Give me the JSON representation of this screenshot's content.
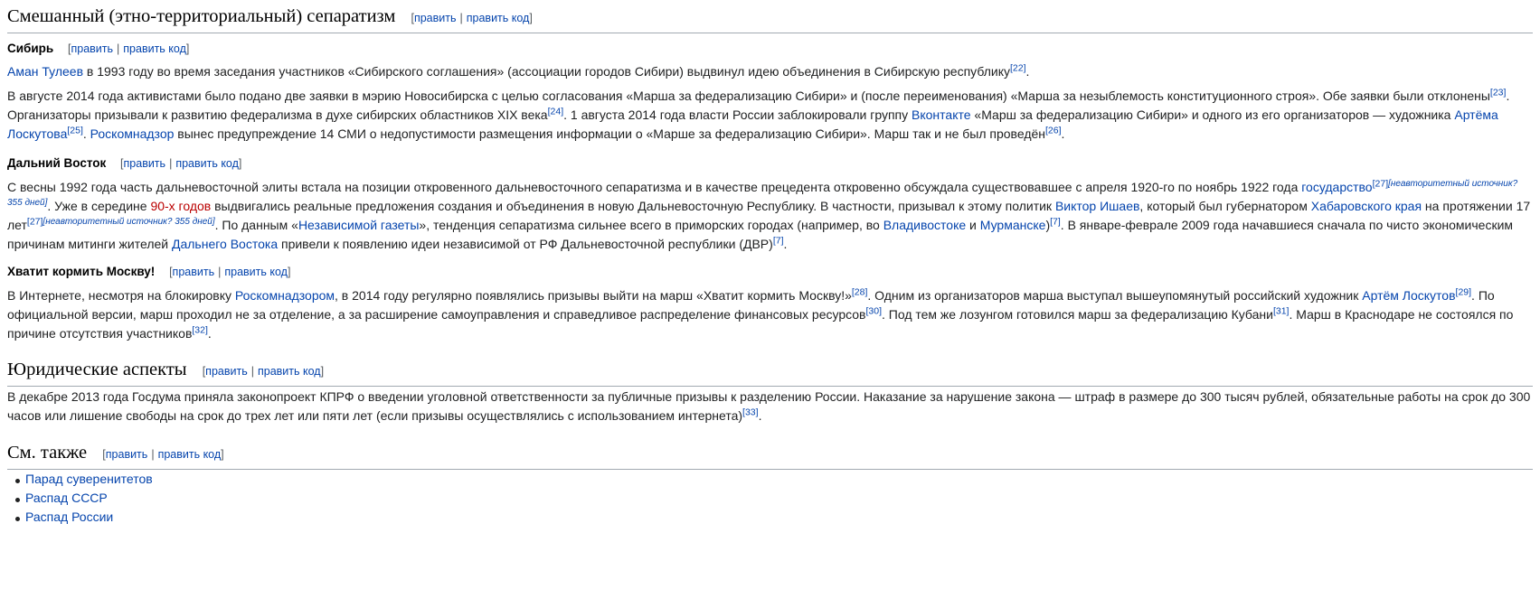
{
  "edit": {
    "edit": "править",
    "edit_code": "править код",
    "open": "[",
    "close": "]",
    "sep": "|"
  },
  "s1": {
    "title": "Смешанный (этно-территориальный) сепаратизм",
    "siberia": {
      "title": "Сибирь",
      "p1": {
        "a1": "Аман Тулеев",
        "t1": " в 1993 году во время заседания участников «Сибирского соглашения» (ассоциации городов Сибири) выдвинул идею объединения в Сибирскую республику",
        "r1": "[22]",
        "t2": "."
      },
      "p2": {
        "t1": "В августе 2014 года активистами было подано две заявки в мэрию Новосибирска с целью согласования «Марша за федерализацию Сибири» и (после переименования) «Марша за незыблемость конституционного строя». Обе заявки были отклонены",
        "r1": "[23]",
        "t2": ". Организаторы призывали к развитию федерализма в духе сибирских областников XIX века",
        "r2": "[24]",
        "t3": ". 1 августа 2014 года власти России заблокировали группу ",
        "a1": "Вконтакте",
        "t4": " «Марш за федерализацию Сибири» и одного из его организаторов — художника ",
        "a2": "Артёма Лоскутова",
        "r3": "[25]",
        "t5": ". ",
        "a3": "Роскомнадзор",
        "t6": " вынес предупреждение 14 СМИ о недопустимости размещения информации о «Марше за федерализацию Сибири». Марш так и не был проведён",
        "r4": "[26]",
        "t7": "."
      }
    },
    "fareast": {
      "title": "Дальний Восток",
      "p1": {
        "t1": "С весны 1992 года часть дальневосточной элиты встала на позиции откровенного дальневосточного сепаратизма и в качестве прецедента откровенно обсуждала существовавшее с апреля 1920-го по ноябрь 1922 года ",
        "a1": "государство",
        "r1": "[27]",
        "n1": "[неавторитетный источник? 355 дней]",
        "t2": ". Уже в середине ",
        "a2": "90-х годов",
        "t3": " выдвигались реальные предложения создания и объединения в новую Дальневосточную Республику. В частности, призывал к этому политик ",
        "a3": "Виктор Ишаев",
        "t4": ", который был губернатором ",
        "a4": "Хабаровского края",
        "t5": " на протяжении 17 лет",
        "r2": "[27]",
        "n2": "[неавторитетный источник? 355 дней]",
        "t6": ". По данным «",
        "a5": "Независимой газеты",
        "t7": "», тенденция сепаратизма сильнее всего в приморских городах (например, во ",
        "a6": "Владивостоке",
        "t8": " и ",
        "a7": "Мурманске",
        "t9": ")",
        "r3": "[7]",
        "t10": ". В январе-феврале 2009 года начавшиеся сначала по чисто экономическим причинам митинги жителей ",
        "a8": "Дальнего Востока",
        "t11": " привели к появлению идеи независимой от РФ Дальневосточной республики (ДВР)",
        "r4": "[7]",
        "t12": "."
      }
    },
    "moscow": {
      "title": "Хватит кормить Москву!",
      "p1": {
        "t1": "В Интернете, несмотря на блокировку ",
        "a1": "Роскомнадзором",
        "t2": ", в 2014 году регулярно появлялись призывы выйти на марш «Хватит кормить Москву!»",
        "r1": "[28]",
        "t3": ". Одним из организаторов марша выступал вышеупомянутый российский художник ",
        "a2": "Артём Лоскутов",
        "r2": "[29]",
        "t4": ". По официальной версии, марш проходил не за отделение, а за расширение самоуправления и справедливое распределение финансовых ресурсов",
        "r3": "[30]",
        "t5": ". Под тем же лозунгом готовился марш за федерализацию Кубани",
        "r4": "[31]",
        "t6": ". Марш в Краснодаре не состоялся по причине отсутствия участников",
        "r5": "[32]",
        "t7": "."
      }
    }
  },
  "s2": {
    "title": "Юридические аспекты",
    "p1": {
      "t1": "В декабре 2013 года Госдума приняла законопроект КПРФ о введении уголовной ответственности за публичные призывы к разделению России. Наказание за нарушение закона — штраф в размере до 300 тысяч рублей, обязательные работы на срок до 300 часов или лишение свободы на срок до трех лет или пяти лет (если призывы осуществлялись с использованием интернета)",
      "r1": "[33]",
      "t2": "."
    }
  },
  "s3": {
    "title": "См. также",
    "items": [
      "Парад суверенитетов",
      "Распад СССР",
      "Распад России"
    ]
  }
}
